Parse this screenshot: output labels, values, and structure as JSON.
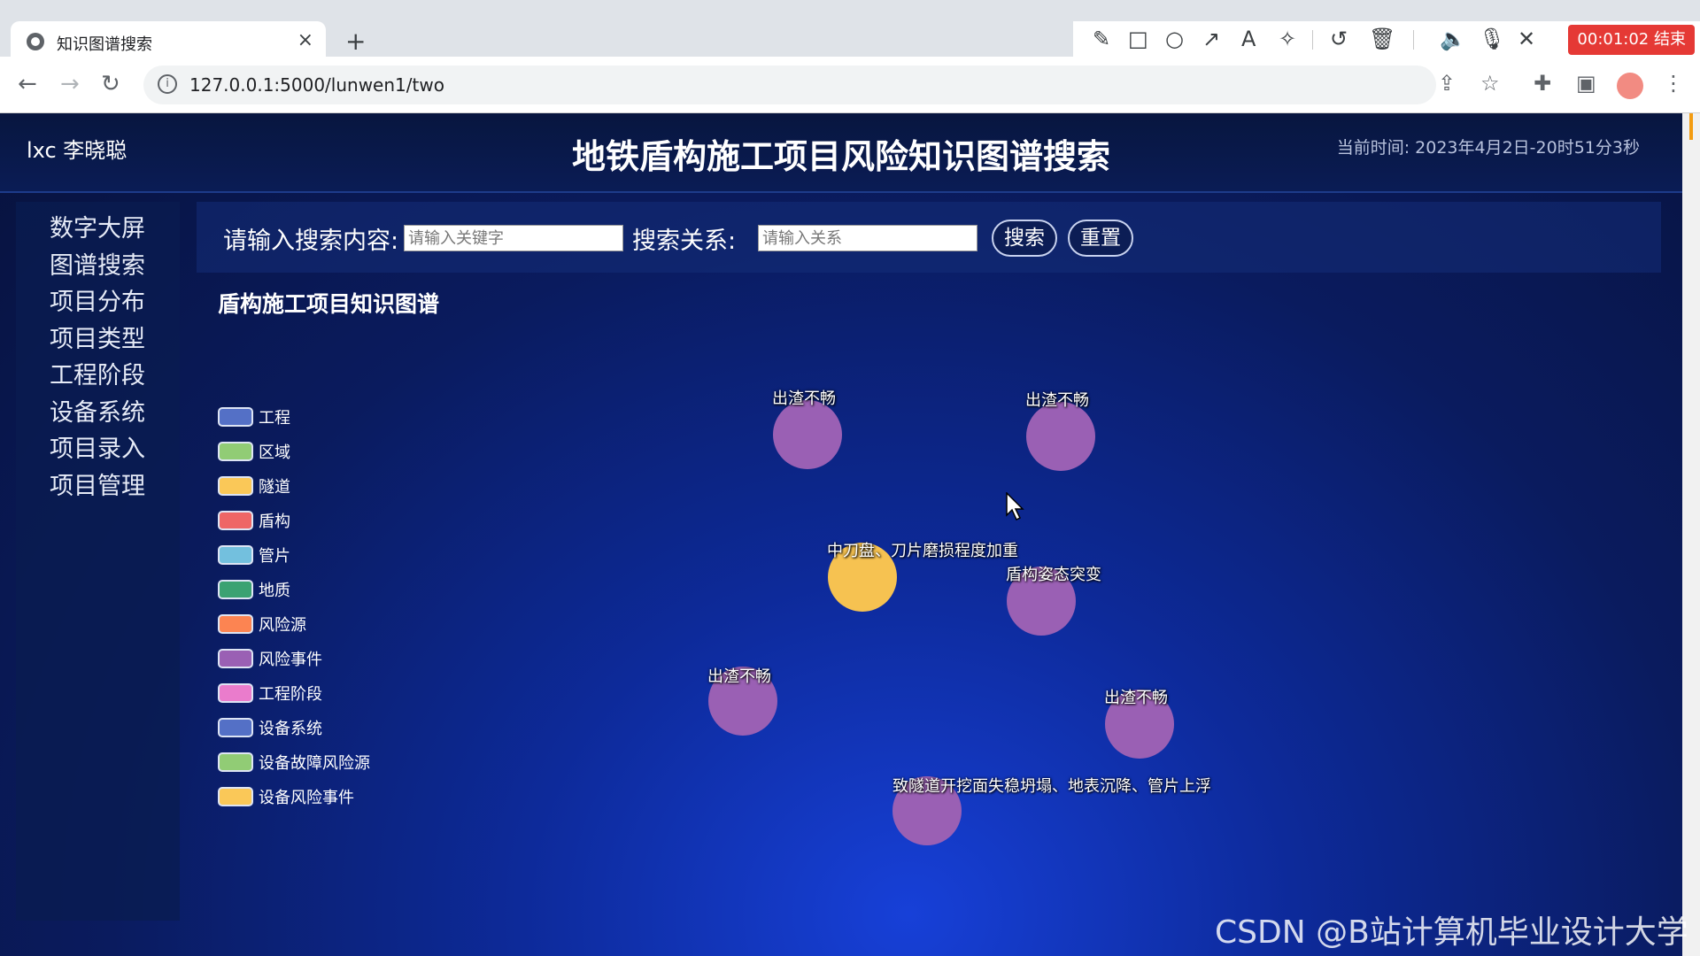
{
  "browser": {
    "tab_title": "知识图谱搜索",
    "tab_close": "×",
    "new_tab": "+",
    "url": "127.0.0.1:5000/lunwen1/two",
    "recording_timer": "00:01:02 结束"
  },
  "header": {
    "user": "lxc 李晓聪",
    "title": "地铁盾构施工项目风险知识图谱搜索",
    "time_label": "当前时间:",
    "time_value": "2023年4月2日-20时51分3秒"
  },
  "sidebar": {
    "items": [
      "数字大屏",
      "图谱搜索",
      "项目分布",
      "项目类型",
      "工程阶段",
      "设备系统",
      "项目录入",
      "项目管理"
    ]
  },
  "search": {
    "content_label": "请输入搜索内容:",
    "content_placeholder": "请输入关键字",
    "relation_label": "搜索关系:",
    "relation_placeholder": "请输入关系",
    "search_button": "搜索",
    "reset_button": "重置"
  },
  "graph": {
    "title": "盾构施工项目知识图谱",
    "legend": [
      {
        "label": "工程",
        "color": "#5470c6"
      },
      {
        "label": "区域",
        "color": "#91cc75"
      },
      {
        "label": "隧道",
        "color": "#fac858"
      },
      {
        "label": "盾构",
        "color": "#ee6666"
      },
      {
        "label": "管片",
        "color": "#73c0de"
      },
      {
        "label": "地质",
        "color": "#3ba272"
      },
      {
        "label": "风险源",
        "color": "#fc8452"
      },
      {
        "label": "风险事件",
        "color": "#9a60b4"
      },
      {
        "label": "工程阶段",
        "color": "#ea7ccc"
      },
      {
        "label": "设备系统",
        "color": "#5470c6"
      },
      {
        "label": "设备故障风险源",
        "color": "#91cc75"
      },
      {
        "label": "设备风险事件",
        "color": "#fac858"
      }
    ],
    "nodes": [
      {
        "label": "出渣不畅",
        "category": "风险事件",
        "color": "#9a60b4"
      },
      {
        "label": "出渣不畅",
        "category": "风险事件",
        "color": "#9a60b4"
      },
      {
        "label": "中刀盘、刀片磨损程度加重",
        "category": "设备风险事件",
        "color": "#f6c251"
      },
      {
        "label": "盾构姿态突变",
        "category": "风险事件",
        "color": "#9a60b4"
      },
      {
        "label": "出渣不畅",
        "category": "风险事件",
        "color": "#9a60b4"
      },
      {
        "label": "出渣不畅",
        "category": "风险事件",
        "color": "#9a60b4"
      },
      {
        "label": "致隧道开挖面失稳坍塌、地表沉降、管片上浮",
        "category": "风险事件",
        "color": "#9a60b4"
      }
    ]
  },
  "watermark": "CSDN @B站计算机毕业设计大学"
}
